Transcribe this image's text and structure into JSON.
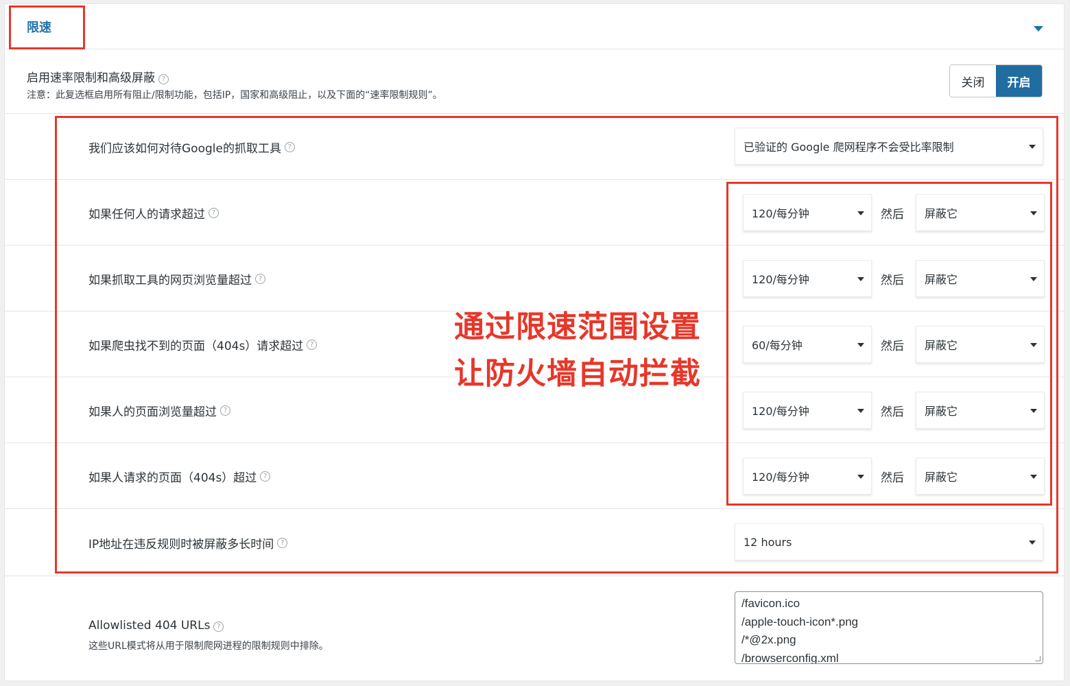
{
  "header": {
    "title": "限速"
  },
  "master": {
    "label": "启用速率限制和高级屏蔽",
    "note": "注意：此复选框启用所有阻止/限制功能，包括IP，国家和高级阻止，以及下面的“速率限制规则”。",
    "toggle_off": "关闭",
    "toggle_on": "开启"
  },
  "google_row": {
    "label": "我们应该如何对待Google的抓取工具",
    "value": "已验证的 Google 爬网程序不会受比率限制"
  },
  "rules": [
    {
      "label": "如果任何人的请求超过",
      "rate": "120/每分钟",
      "then": "然后",
      "action": "屏蔽它"
    },
    {
      "label": "如果抓取工具的网页浏览量超过",
      "rate": "120/每分钟",
      "then": "然后",
      "action": "屏蔽它"
    },
    {
      "label": "如果爬虫找不到的页面（404s）请求超过",
      "rate": "60/每分钟",
      "then": "然后",
      "action": "屏蔽它"
    },
    {
      "label": "如果人的页面浏览量超过",
      "rate": "120/每分钟",
      "then": "然后",
      "action": "屏蔽它"
    },
    {
      "label": "如果人请求的页面（404s）超过",
      "rate": "120/每分钟",
      "then": "然后",
      "action": "屏蔽它"
    }
  ],
  "block_duration": {
    "label": "IP地址在违反规则时被屏蔽多长时间",
    "value": "12 hours"
  },
  "allowlist": {
    "label": "Allowlisted 404 URLs",
    "note": "这些URL模式将从用于限制爬网进程的限制规则中排除。",
    "lines": [
      "/favicon.ico",
      "/apple-touch-icon*.png",
      "/*@2x.png",
      "/browserconfig.xml"
    ]
  },
  "help_glyph": "?",
  "annotation": {
    "line1": "通过限速范围设置",
    "line2": "让防火墙自动拦截",
    "color": "#e6372a"
  },
  "colors": {
    "accent": "#216da2",
    "title": "#1f72a8"
  }
}
